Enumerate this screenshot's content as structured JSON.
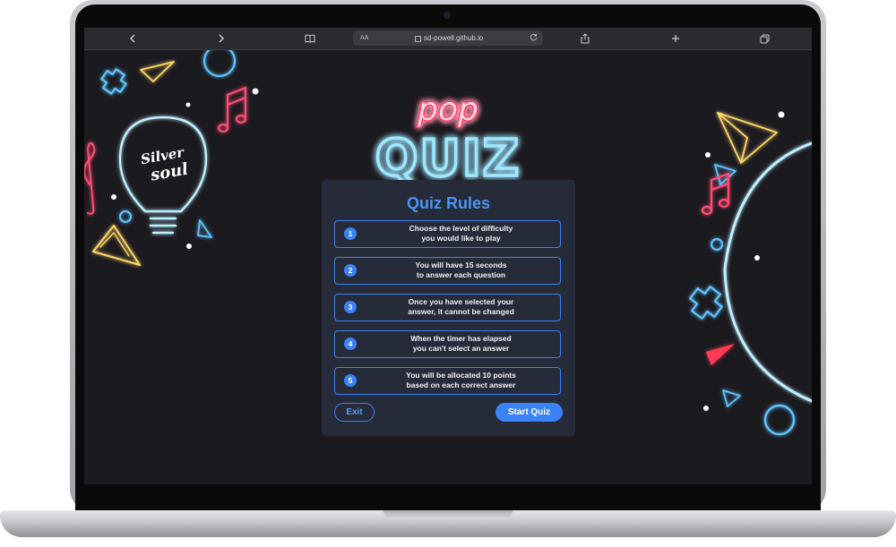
{
  "browser": {
    "url_prefix": "AA",
    "url": "sd-powell.github.io",
    "icons": {
      "back": "chevron-left-icon",
      "forward": "chevron-right-icon",
      "reader": "book-icon",
      "reload": "reload-icon",
      "share": "share-icon",
      "new_tab": "plus-icon",
      "tabs": "tabs-icon"
    }
  },
  "header": {
    "logo_top": "pop",
    "logo_bottom": "QUIZ",
    "badge_line1": "Silver",
    "badge_line2": "soul"
  },
  "rules": {
    "title": "Quiz Rules",
    "items": [
      {
        "number": "1",
        "text": "Choose the level of difficulty\nyou would like to play"
      },
      {
        "number": "2",
        "text": "You will have 15 seconds\nto answer each question"
      },
      {
        "number": "3",
        "text": "Once you have selected your\nanswer, it cannot be changed"
      },
      {
        "number": "4",
        "text": "When the timer has elapsed\nyou can't select an answer"
      },
      {
        "number": "5",
        "text": "You will be allocated 10 points\nbased on each correct answer"
      }
    ],
    "exit_label": "Exit",
    "start_label": "Start Quiz"
  },
  "colors": {
    "accent": "#3b82f6",
    "neon_pink": "#ff3b6b",
    "neon_blue": "#6fd6ff",
    "neon_yellow": "#ffd86a",
    "background": "#1b1a1f",
    "card": "#262b3a"
  }
}
